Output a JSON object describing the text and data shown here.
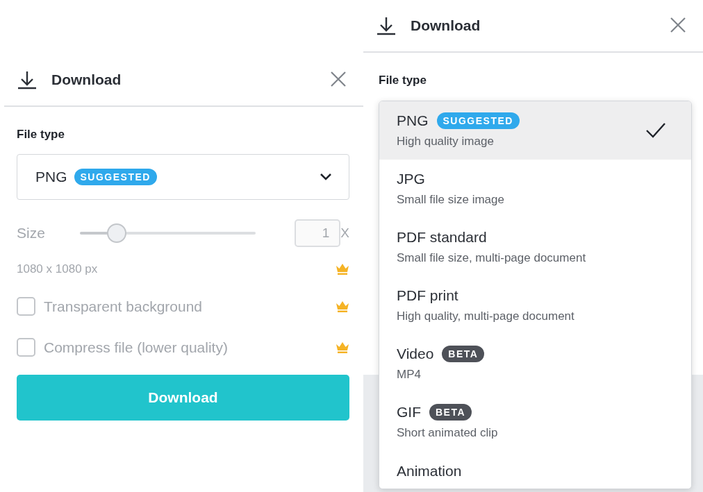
{
  "download_panel": {
    "title": "Download",
    "file_type": {
      "label": "File type",
      "value": "PNG",
      "badge": {
        "text": "SUGGESTED",
        "kind": "suggested"
      }
    },
    "size": {
      "label": "Size",
      "level": 0.2,
      "value": "1",
      "unit": "X",
      "disabled": true
    },
    "dimensions": {
      "text": "1080 x 1080 px",
      "premium": true
    },
    "options": [
      {
        "label": "Transparent background",
        "checked": false,
        "disabled": true,
        "premium": true
      },
      {
        "label": "Compress file (lower quality)",
        "checked": false,
        "disabled": true,
        "premium": true
      }
    ],
    "button": "Download"
  },
  "file_type_panel": {
    "title": "Download",
    "label": "File type",
    "menu": [
      {
        "label": "PNG",
        "badge": {
          "text": "SUGGESTED",
          "kind": "suggested"
        },
        "description": "High quality image",
        "selected": true
      },
      {
        "label": "JPG",
        "description": "Small file size image",
        "selected": false
      },
      {
        "label": "PDF standard",
        "description": "Small file size, multi-page document",
        "selected": false
      },
      {
        "label": "PDF print",
        "description": "High quality, multi-page document",
        "selected": false
      },
      {
        "label": "Video",
        "badge": {
          "text": "BETA",
          "kind": "beta"
        },
        "description": "MP4",
        "selected": false
      },
      {
        "label": "GIF",
        "badge": {
          "text": "BETA",
          "kind": "beta"
        },
        "description": "Short animated clip",
        "selected": false
      },
      {
        "label": "Animation",
        "selected": false
      }
    ]
  }
}
